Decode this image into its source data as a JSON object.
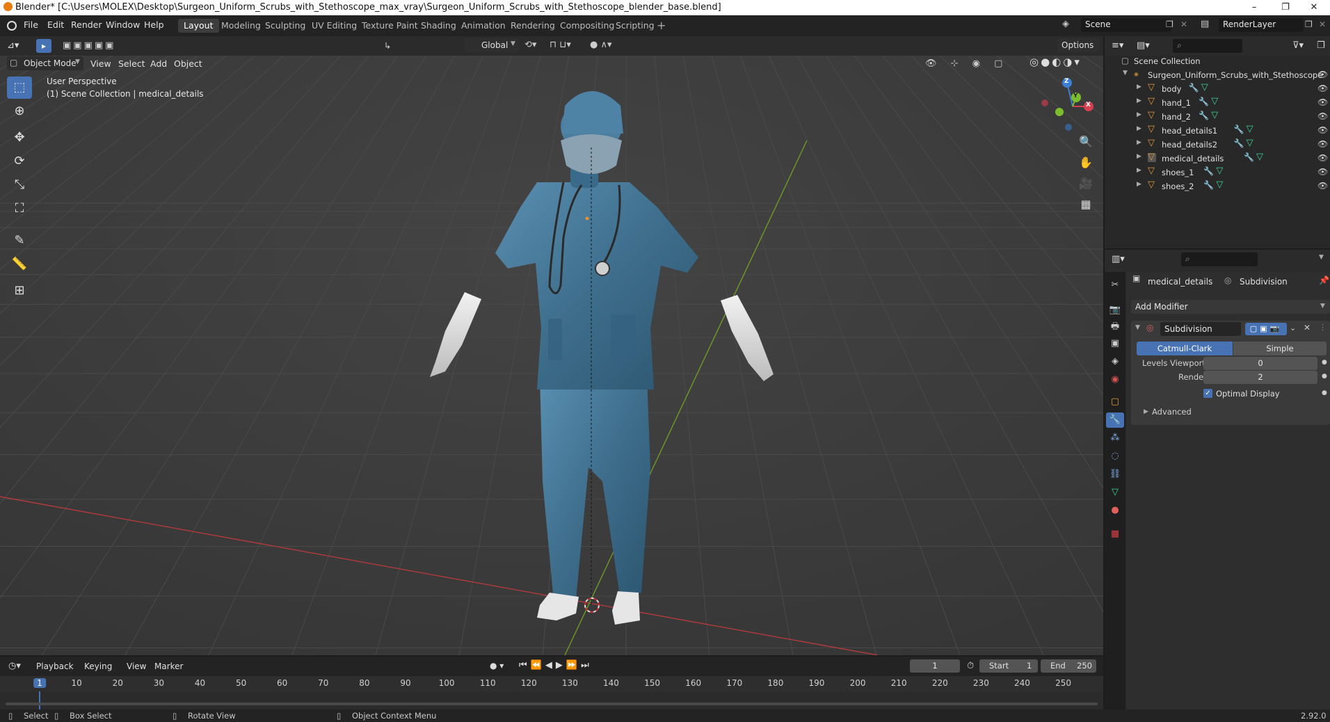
{
  "window": {
    "title": "Blender* [C:\\Users\\MOLEX\\Desktop\\Surgeon_Uniform_Scrubs_with_Stethoscope_max_vray\\Surgeon_Uniform_Scrubs_with_Stethoscope_blender_base.blend]",
    "controls": [
      "–",
      "❐",
      "✕"
    ]
  },
  "menubar": [
    "File",
    "Edit",
    "Render",
    "Window",
    "Help"
  ],
  "workspaces": [
    "Layout",
    "Modeling",
    "Sculpting",
    "UV Editing",
    "Texture Paint",
    "Shading",
    "Animation",
    "Rendering",
    "Compositing",
    "Scripting"
  ],
  "active_workspace": "Layout",
  "scene": {
    "label": "Scene",
    "render_layer": "RenderLayer"
  },
  "viewport_header": {
    "mode": "Object Mode",
    "menus": [
      "View",
      "Select",
      "Add",
      "Object"
    ],
    "transform": "Global",
    "options": "Options"
  },
  "viewport": {
    "perspective": "User Perspective",
    "collection_info": "(1) Scene Collection | medical_details",
    "gizmo_axes": {
      "z": "Z",
      "y": "Y",
      "x": "X"
    }
  },
  "outliner": {
    "root": "Scene Collection",
    "collection": "Surgeon_Uniform_Scrubs_with_Stethoscope",
    "items": [
      "body",
      "hand_1",
      "hand_2",
      "head_details1",
      "head_details2",
      "medical_details",
      "shoes_1",
      "shoes_2"
    ]
  },
  "properties": {
    "object_name": "medical_details",
    "modifier_crumb": "Subdivision",
    "add_modifier": "Add Modifier",
    "modifier_name": "Subdivision",
    "catmull": "Catmull-Clark",
    "simple": "Simple",
    "levels_label": "Levels Viewport",
    "levels_value": "0",
    "render_label": "Render",
    "render_value": "2",
    "optimal_display": "Optimal Display",
    "advanced": "Advanced"
  },
  "timeline": {
    "menus": [
      "Playback",
      "Keying",
      "View",
      "Marker"
    ],
    "current_frame": "1",
    "start_label": "Start",
    "start_value": "1",
    "end_label": "End",
    "end_value": "250",
    "ticks": [
      "1",
      "10",
      "20",
      "30",
      "40",
      "50",
      "60",
      "70",
      "80",
      "90",
      "100",
      "110",
      "120",
      "130",
      "140",
      "150",
      "160",
      "170",
      "180",
      "190",
      "200",
      "210",
      "220",
      "230",
      "240",
      "250"
    ]
  },
  "statusbar": {
    "select": "Select",
    "box_select": "Box Select",
    "rotate": "Rotate View",
    "context": "Object Context Menu",
    "version": "2.92.0"
  },
  "colors": {
    "accent": "#4772b3",
    "scrubs": "#3f6f8e",
    "x_axis": "#c0393b",
    "y_axis": "#7bac2a"
  }
}
